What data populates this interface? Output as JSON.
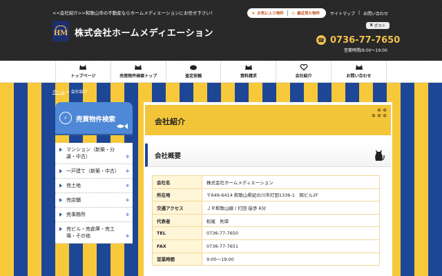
{
  "header": {
    "tagline": "<<会社紹介>>和歌山市の不動産ならホームメディエーションにお任せ下さい！",
    "logo_letters": "HM",
    "company_name": "株式会社ホームメディエーション",
    "favorites": "お気に入り物件",
    "recent": "最近見た物件",
    "sitemap": "サイトマップ",
    "contact": "お問い合わせ",
    "post": "ポスト",
    "phone": "0736-77-7650",
    "hours": "営業時間/9:00～19:00"
  },
  "nav": [
    {
      "label": "トップページ"
    },
    {
      "label": "売買物件検索トップ"
    },
    {
      "label": "査定依頼"
    },
    {
      "label": "資料請求"
    },
    {
      "label": "会社紹介"
    },
    {
      "label": "お問い合わせ"
    }
  ],
  "breadcrumb": {
    "home": "ホーム",
    "current": "会社紹介"
  },
  "sidebar": {
    "title": "売買物件検索",
    "items": [
      {
        "label": "マンション（新築・分譲・中古）"
      },
      {
        "label": "一戸建て（新築・中古）"
      },
      {
        "label": "売土地"
      },
      {
        "label": "売店舗"
      },
      {
        "label": "売事務所"
      },
      {
        "label": "売ビル・売倉庫・売工場・その他"
      }
    ]
  },
  "main": {
    "title": "会社紹介",
    "section_title": "会社概要",
    "rows": [
      {
        "key": "会社名",
        "value": "株式会社ホームメディエーション"
      },
      {
        "key": "所在地",
        "value": "〒649-6414 和歌山県紀の川市打田1336-1　岡ビル2F"
      },
      {
        "key": "交通アクセス",
        "value": "ＪＲ和歌山線 / 打田 徒歩 6分"
      },
      {
        "key": "代表者",
        "value": "松尾　則幸"
      },
      {
        "key": "TEL",
        "value": "0736-77-7650"
      },
      {
        "key": "FAX",
        "value": "0736-77-7651"
      },
      {
        "key": "営業時間",
        "value": "9:00～19:00"
      }
    ]
  },
  "colors": {
    "stripe_yellow": "#f7c93a",
    "stripe_blue": "#1d4796",
    "header_bg": "#262626",
    "accent_yellow": "#f2c14e",
    "sidebar_blue": "#4f88d6"
  }
}
